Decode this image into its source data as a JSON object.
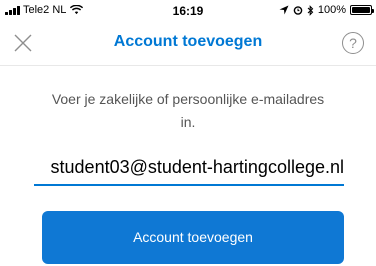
{
  "status_bar": {
    "carrier": "Tele2 NL",
    "time": "16:19",
    "battery": "100%",
    "battery_level": 1.0
  },
  "nav": {
    "title": "Account toevoegen",
    "help_label": "?"
  },
  "main": {
    "instruction": "Voer je zakelijke of persoonlijke e-mailadres in.",
    "email_value": "student03@student-hartingcollege.nl",
    "submit_label": "Account toevoegen"
  },
  "colors": {
    "accent": "#0078d4",
    "button": "#0f78d4",
    "instruction_text": "#555555"
  },
  "icons": [
    "signal-icon",
    "wifi-icon",
    "location-icon",
    "alarm-icon",
    "bluetooth-icon",
    "battery-icon",
    "close-icon",
    "help-icon"
  ]
}
